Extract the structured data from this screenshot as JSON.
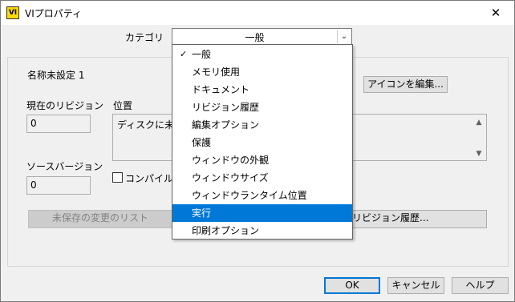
{
  "window": {
    "title": "VIプロパティ",
    "app_icon_text": "VI",
    "close_glyph": "✕"
  },
  "category": {
    "label": "カテゴリ",
    "value": "一般",
    "arrow_glyph": "⌄"
  },
  "general": {
    "vi_name": "名称未設定 1",
    "edit_icon_button": "アイコンを編集...",
    "current_revision_label": "現在のリビジョン",
    "current_revision_value": "0",
    "location_label": "位置",
    "location_value": "ディスクに未保存",
    "source_version_label": "ソースバージョン",
    "source_version_value": "0",
    "compile_checkbox_label": "コンパイル",
    "unsaved_changes_button": "未保存の変更のリスト",
    "revision_history_button": "リビジョン履歴..."
  },
  "dropdown": {
    "check_glyph": "✓",
    "items": [
      {
        "label": "一般",
        "checked": true
      },
      {
        "label": "メモリ使用"
      },
      {
        "label": "ドキュメント"
      },
      {
        "label": "リビジョン履歴"
      },
      {
        "label": "編集オプション"
      },
      {
        "label": "保護"
      },
      {
        "label": "ウィンドウの外観"
      },
      {
        "label": "ウィンドウサイズ"
      },
      {
        "label": "ウィンドウランタイム位置"
      },
      {
        "label": "実行",
        "highlighted": true
      },
      {
        "label": "印刷オプション"
      }
    ]
  },
  "footer": {
    "ok": "OK",
    "cancel": "キャンセル",
    "help": "ヘルプ"
  }
}
